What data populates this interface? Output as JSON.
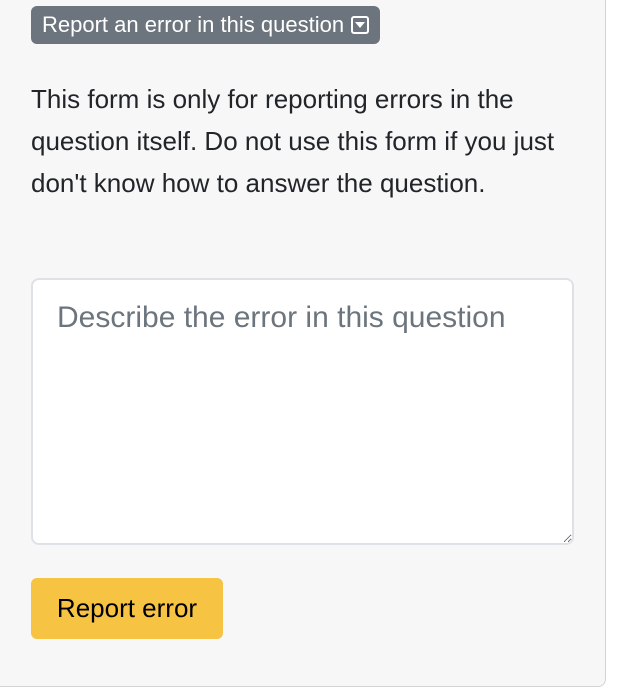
{
  "toggle": {
    "label": "Report an error in this question",
    "icon": "caret-down-square-icon"
  },
  "form": {
    "description": "This form is only for reporting errors in the question itself. Do not use this form if you just don't know how to answer the question.",
    "textarea_placeholder": "Describe the error in this question",
    "textarea_value": "",
    "submit_label": "Report error"
  },
  "colors": {
    "toggle_bg": "#6c757d",
    "submit_bg": "#f6c343",
    "panel_bg": "#f7f7f7"
  }
}
